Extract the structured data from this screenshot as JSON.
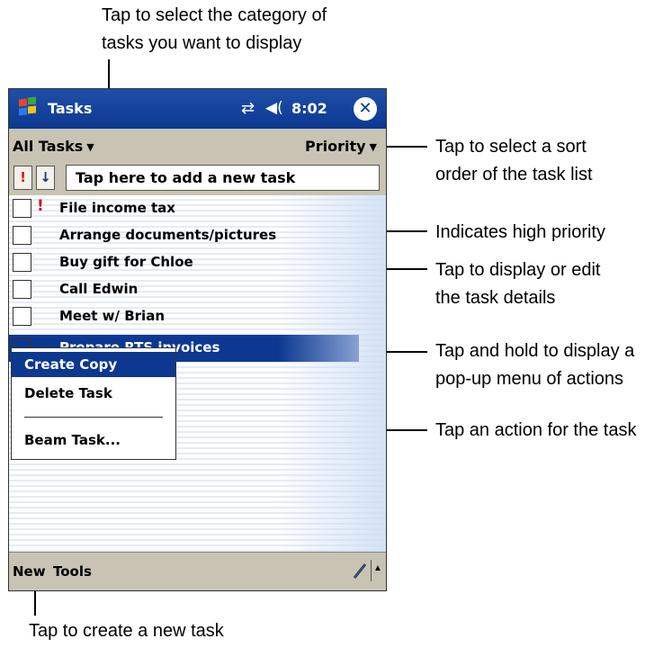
{
  "callouts": {
    "category": "Tap to select the category of\ntasks you want to display",
    "sort": "Tap to select a sort\norder of the task list",
    "priority": "Indicates high priority",
    "details": "Tap to display or edit\nthe task details",
    "hold": "Tap and hold to display a\npop-up menu of actions",
    "action": "Tap an action for the task",
    "new": "Tap to create a new task"
  },
  "titlebar": {
    "app_title": "Tasks",
    "clock": "8:02",
    "connectivity_icon": "connectivity-icon",
    "volume_icon": "speaker-icon",
    "close_icon": "close-icon",
    "start_icon": "windows-flag-icon"
  },
  "filterbar": {
    "category": "All Tasks",
    "sort": "Priority"
  },
  "entrybar": {
    "priority_button": "!",
    "sort_button": "↓",
    "new_task": "Tap here to add a new task"
  },
  "tasks": [
    {
      "label": "File income tax",
      "high_priority": true,
      "priority_mark": "!",
      "selected": false
    },
    {
      "label": "Arrange documents/pictures",
      "high_priority": false,
      "selected": false
    },
    {
      "label": "Buy gift for Chloe",
      "high_priority": false,
      "selected": false
    },
    {
      "label": "Call Edwin",
      "high_priority": false,
      "selected": false
    },
    {
      "label": "Meet w/ Brian",
      "high_priority": false,
      "selected": false
    },
    {
      "label": "Prepare RTS invoices",
      "high_priority": false,
      "selected": true
    }
  ],
  "context_menu": {
    "items": [
      "Create Copy",
      "Delete Task",
      "Beam Task..."
    ],
    "highlighted": "Create Copy"
  },
  "bottombar": {
    "new": "New",
    "tools": "Tools",
    "pen_icon": "pen-icon",
    "sip_icon": "up-arrow-icon"
  },
  "colors": {
    "titlebar": "#0c3891",
    "selection": "#0c3891",
    "priority": "#c81a14",
    "chrome": "#c8c3b3"
  }
}
